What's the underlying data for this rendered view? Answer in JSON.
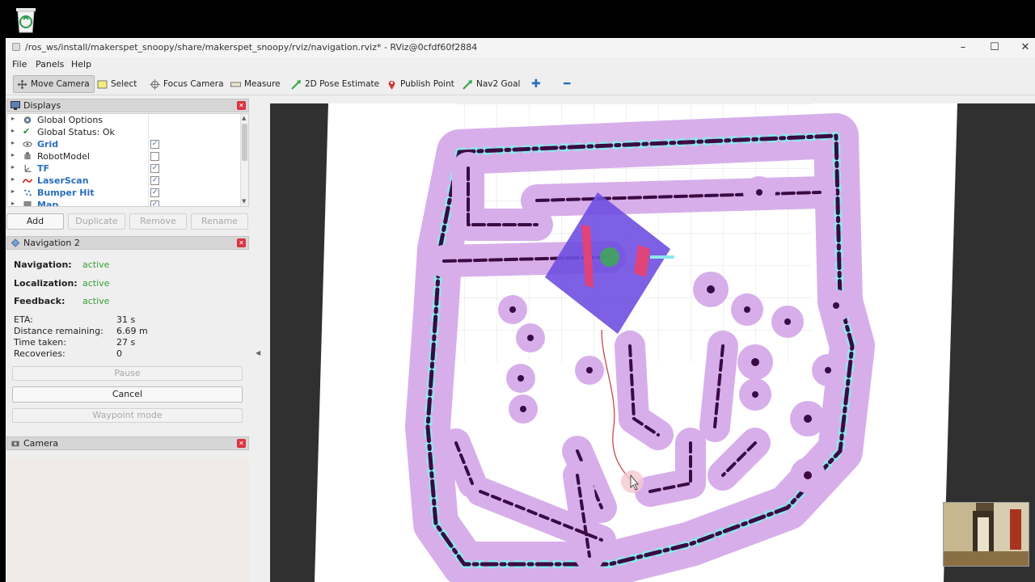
{
  "window": {
    "title": "/ros_ws/install/makerspet_snoopy/share/makerspet_snoopy/rviz/navigation.rviz* - RViz@0cfdf60f2884"
  },
  "menubar": {
    "items": [
      {
        "label": "File"
      },
      {
        "label": "Panels"
      },
      {
        "label": "Help"
      }
    ]
  },
  "toolbar": {
    "tools": [
      {
        "label": "Move Camera",
        "icon": "move-camera-icon"
      },
      {
        "label": "Select",
        "icon": "select-icon"
      },
      {
        "label": "Focus Camera",
        "icon": "focus-camera-icon"
      },
      {
        "label": "Measure",
        "icon": "measure-icon"
      },
      {
        "label": "2D Pose Estimate",
        "icon": "pose-estimate-icon"
      },
      {
        "label": "Publish Point",
        "icon": "publish-point-icon"
      },
      {
        "label": "Nav2 Goal",
        "icon": "nav2-goal-icon"
      }
    ]
  },
  "displays_panel": {
    "title": "Displays",
    "items": [
      {
        "label": "Global Options",
        "checked": null
      },
      {
        "label": "Global Status: Ok",
        "checked": null
      },
      {
        "label": "Grid",
        "checked": true
      },
      {
        "label": "RobotModel",
        "checked": false
      },
      {
        "label": "TF",
        "checked": true
      },
      {
        "label": "LaserScan",
        "checked": true
      },
      {
        "label": "Bumper Hit",
        "checked": true
      },
      {
        "label": "Map",
        "checked": true
      }
    ],
    "buttons": {
      "add": "Add",
      "duplicate": "Duplicate",
      "remove": "Remove",
      "rename": "Rename"
    }
  },
  "navigation_panel": {
    "title": "Navigation 2",
    "navigation_label": "Navigation:",
    "navigation_value": "active",
    "localization_label": "Localization:",
    "localization_value": "active",
    "feedback_label": "Feedback:",
    "feedback_value": "active",
    "eta_label": "ETA:",
    "eta_value": "31 s",
    "distance_label": "Distance remaining:",
    "distance_value": "6.69 m",
    "time_label": "Time taken:",
    "time_value": "27 s",
    "recoveries_label": "Recoveries:",
    "recoveries_value": "0",
    "pause": "Pause",
    "cancel": "Cancel",
    "waypoint": "Waypoint mode"
  },
  "camera_panel": {
    "title": "Camera"
  },
  "colors": {
    "costmap": "#cfa0e6",
    "inflation": "#8ee8ec",
    "obstacle": "#3a0a42",
    "local_costmap": "#6f4fe0",
    "status_green": "#35a035"
  }
}
